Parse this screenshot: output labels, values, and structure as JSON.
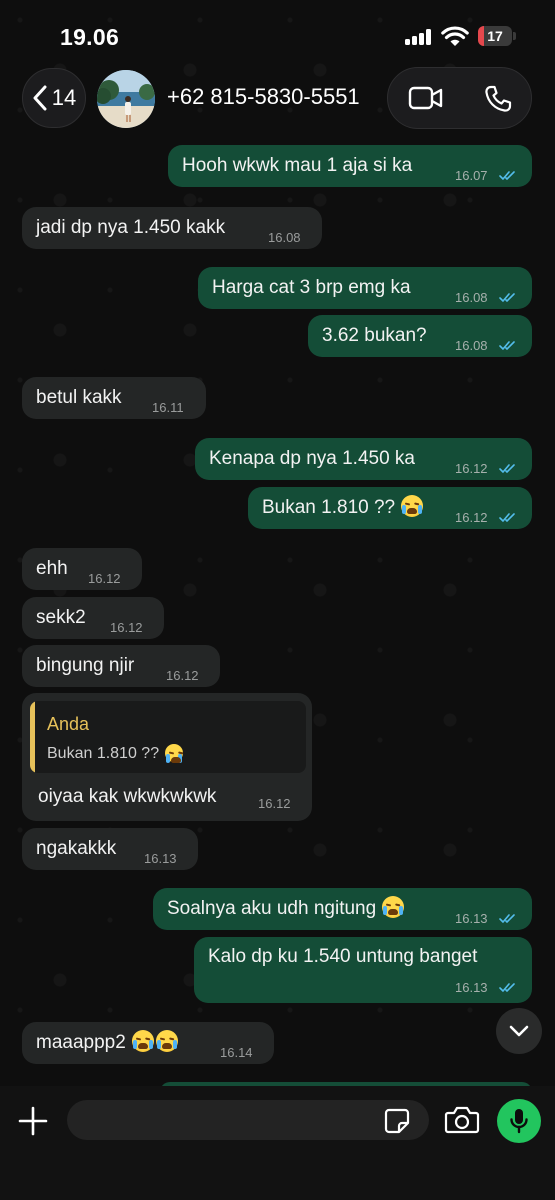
{
  "status_bar": {
    "time": "19.06",
    "battery": "17",
    "battery_level": 0.17,
    "battery_color": "#e5484d"
  },
  "header": {
    "back_count": "14",
    "contact_name": "+62 815-5830-5551"
  },
  "messages": [
    {
      "dir": "out",
      "text": "Hooh wkwk mau 1 aja si ka",
      "time": "16.07",
      "read": true
    },
    {
      "dir": "in",
      "text": "jadi dp nya 1.450 kakk",
      "time": "16.08"
    },
    {
      "dir": "out",
      "text": "Harga cat 3 brp emg ka",
      "time": "16.08",
      "read": true
    },
    {
      "dir": "out",
      "text": "3.62 bukan?",
      "time": "16.08",
      "read": true
    },
    {
      "dir": "in",
      "text": "betul kakk",
      "time": "16.11"
    },
    {
      "dir": "out",
      "text": "Kenapa dp nya 1.450 ka",
      "time": "16.12",
      "read": true
    },
    {
      "dir": "out",
      "text": "Bukan 1.810 ??",
      "time": "16.12",
      "read": true,
      "emoji": [
        "loudly-crying-face"
      ]
    },
    {
      "dir": "in",
      "text": "ehh",
      "time": "16.12"
    },
    {
      "dir": "in",
      "text": "sekk2",
      "time": "16.12"
    },
    {
      "dir": "in",
      "text": "bingung njir",
      "time": "16.12"
    },
    {
      "dir": "in",
      "text": "ngakakkk",
      "time": "16.13"
    },
    {
      "dir": "out",
      "text": "Soalnya aku udh ngitung",
      "time": "16.13",
      "read": true,
      "emoji": [
        "loudly-crying-face"
      ]
    },
    {
      "dir": "out",
      "text": "Kalo dp ku 1.540 untung banget",
      "time": "16.13",
      "read": true
    },
    {
      "dir": "in",
      "text": "maaappp2",
      "time": "16.14",
      "emoji": [
        "loudly-crying-face",
        "loudly-crying-face"
      ]
    }
  ],
  "reply_message": {
    "quote_author": "Anda",
    "quote_text": "Bukan 1.810 ??",
    "text": "oiyaa kak wkwkwkwk",
    "time": "16.12"
  },
  "input": {
    "placeholder": ""
  },
  "colors": {
    "outgoing_bubble": "#144d37",
    "incoming_bubble": "#242626",
    "read_ticks": "#53bdeb",
    "mic_button": "#22c55e",
    "quote_accent": "#e6c15a"
  }
}
